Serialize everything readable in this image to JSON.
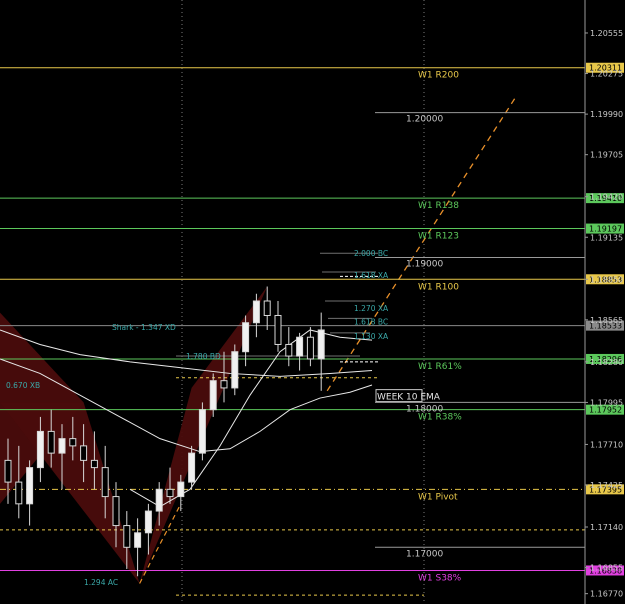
{
  "chart_data": {
    "type": "candlestick",
    "ylim": [
      1.1665,
      1.2075
    ],
    "axis_ticks": [
      {
        "value": 1.2055,
        "label": "1.20555"
      },
      {
        "value": 1.2027,
        "label": "1.20275"
      },
      {
        "value": 1.1999,
        "label": "1.19990"
      },
      {
        "value": 1.1971,
        "label": "1.19705"
      },
      {
        "value": 1.1942,
        "label": "1.19420"
      },
      {
        "value": 1.1914,
        "label": "1.19135"
      },
      {
        "value": 1.1885,
        "label": "1.18850"
      },
      {
        "value": 1.1857,
        "label": "1.18565"
      },
      {
        "value": 1.1828,
        "label": "1.18280"
      },
      {
        "value": 1.18,
        "label": "1.17995"
      },
      {
        "value": 1.1771,
        "label": "1.17710"
      },
      {
        "value": 1.1743,
        "label": "1.17425"
      },
      {
        "value": 1.1714,
        "label": "1.17140"
      },
      {
        "value": 1.1686,
        "label": "1.16855"
      },
      {
        "value": 1.1668,
        "label": "1.16770"
      }
    ],
    "levels": [
      {
        "value": 1.2031,
        "label": "W1 R200",
        "badge": "1.20311",
        "color": "#e8c84a",
        "style": "solid"
      },
      {
        "value": 1.1941,
        "label": "W1 R138",
        "badge": "1.19410",
        "color": "#5cc85c",
        "style": "solid"
      },
      {
        "value": 1.192,
        "label": "W1 R123",
        "badge": "1.19197",
        "color": "#5cc85c",
        "style": "solid"
      },
      {
        "value": 1.1885,
        "label": "W1 R100",
        "badge": "1.18853",
        "color": "#e8c84a",
        "style": "solid"
      },
      {
        "value": 1.1853,
        "label": "",
        "badge": "1.18533",
        "color": "#8a8a8a",
        "style": "solid"
      },
      {
        "value": 1.183,
        "label": "W1 R61%",
        "badge": "1.18296",
        "color": "#5cc85c",
        "style": "solid"
      },
      {
        "value": 1.1795,
        "label": "W1 R38%",
        "badge": "1.17952",
        "color": "#5cc85c",
        "style": "solid"
      },
      {
        "value": 1.174,
        "label": "W1 Pivot",
        "badge": "1.17395",
        "color": "#e8c84a",
        "style": "dashdot"
      },
      {
        "value": 1.1684,
        "label": "W1 S38%",
        "badge": "1.16838",
        "color": "#e040e0",
        "style": "solid"
      }
    ],
    "round_numbers": [
      {
        "value": 1.2,
        "label": "1.20000"
      },
      {
        "value": 1.19,
        "label": "1.19000"
      },
      {
        "value": 1.18,
        "label": "1.18000"
      },
      {
        "value": 1.17,
        "label": "1.17000"
      }
    ],
    "pattern_labels": [
      {
        "text": "2.000 BC",
        "value": 1.1903
      },
      {
        "text": "1.618 XA",
        "value": 1.1888
      },
      {
        "text": "1.270 XA",
        "value": 1.1865
      },
      {
        "text": "1.618 BC",
        "value": 1.1856
      },
      {
        "text": "1.130 XA",
        "value": 1.1846
      },
      {
        "text": "Shark - 1.347 XD",
        "value": 1.1852
      },
      {
        "text": "1.780 BD",
        "value": 1.1832
      },
      {
        "text": "0.670 XB",
        "value": 1.1812
      },
      {
        "text": "1.294 AC",
        "value": 1.1676
      }
    ],
    "ema_label": "WEEK 10 EMA",
    "candles": [
      {
        "o": 1.176,
        "h": 1.1775,
        "l": 1.173,
        "c": 1.1745
      },
      {
        "o": 1.1745,
        "h": 1.177,
        "l": 1.172,
        "c": 1.173
      },
      {
        "o": 1.173,
        "h": 1.176,
        "l": 1.1715,
        "c": 1.1755
      },
      {
        "o": 1.1755,
        "h": 1.179,
        "l": 1.1745,
        "c": 1.178
      },
      {
        "o": 1.178,
        "h": 1.1795,
        "l": 1.1755,
        "c": 1.1765
      },
      {
        "o": 1.1765,
        "h": 1.1785,
        "l": 1.174,
        "c": 1.1775
      },
      {
        "o": 1.1775,
        "h": 1.179,
        "l": 1.176,
        "c": 1.177
      },
      {
        "o": 1.177,
        "h": 1.1785,
        "l": 1.1745,
        "c": 1.176
      },
      {
        "o": 1.176,
        "h": 1.178,
        "l": 1.174,
        "c": 1.1755
      },
      {
        "o": 1.1755,
        "h": 1.177,
        "l": 1.172,
        "c": 1.1735
      },
      {
        "o": 1.1735,
        "h": 1.1745,
        "l": 1.17,
        "c": 1.1715
      },
      {
        "o": 1.1715,
        "h": 1.1725,
        "l": 1.1685,
        "c": 1.17
      },
      {
        "o": 1.17,
        "h": 1.172,
        "l": 1.168,
        "c": 1.171
      },
      {
        "o": 1.171,
        "h": 1.173,
        "l": 1.1695,
        "c": 1.1725
      },
      {
        "o": 1.1725,
        "h": 1.1745,
        "l": 1.1715,
        "c": 1.174
      },
      {
        "o": 1.174,
        "h": 1.1755,
        "l": 1.173,
        "c": 1.1735
      },
      {
        "o": 1.1735,
        "h": 1.175,
        "l": 1.1725,
        "c": 1.1745
      },
      {
        "o": 1.1745,
        "h": 1.177,
        "l": 1.174,
        "c": 1.1765
      },
      {
        "o": 1.1765,
        "h": 1.18,
        "l": 1.176,
        "c": 1.1795
      },
      {
        "o": 1.1795,
        "h": 1.182,
        "l": 1.179,
        "c": 1.1815
      },
      {
        "o": 1.1815,
        "h": 1.1835,
        "l": 1.18,
        "c": 1.181
      },
      {
        "o": 1.181,
        "h": 1.184,
        "l": 1.1805,
        "c": 1.1835
      },
      {
        "o": 1.1835,
        "h": 1.186,
        "l": 1.1825,
        "c": 1.1855
      },
      {
        "o": 1.1855,
        "h": 1.1875,
        "l": 1.1845,
        "c": 1.187
      },
      {
        "o": 1.187,
        "h": 1.188,
        "l": 1.185,
        "c": 1.186
      },
      {
        "o": 1.186,
        "h": 1.187,
        "l": 1.1835,
        "c": 1.184
      },
      {
        "o": 1.184,
        "h": 1.1852,
        "l": 1.1825,
        "c": 1.1832
      },
      {
        "o": 1.1832,
        "h": 1.1848,
        "l": 1.1822,
        "c": 1.1845
      },
      {
        "o": 1.1845,
        "h": 1.1852,
        "l": 1.1825,
        "c": 1.183
      },
      {
        "o": 1.183,
        "h": 1.1862,
        "l": 1.1808,
        "c": 1.185
      }
    ]
  }
}
